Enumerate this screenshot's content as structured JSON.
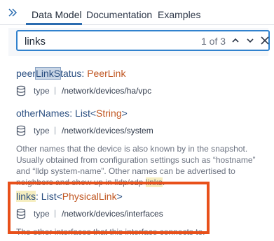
{
  "tabs": {
    "collapse_icon": "double-chevron-right-icon",
    "items": [
      {
        "label": "Data Model",
        "active": true
      },
      {
        "label": "Documentation",
        "active": false
      },
      {
        "label": "Examples",
        "active": false
      }
    ]
  },
  "search": {
    "value": "links",
    "match_count": "1 of 3",
    "prev_icon": "chevron-up-icon",
    "next_icon": "chevron-down-icon",
    "clear_icon": "close-icon"
  },
  "entries": [
    {
      "name_prefix": "peer",
      "name_match": "LinkS",
      "name_suffix": "tatus",
      "colon": ": ",
      "type": "PeerLink",
      "meta_label": "type",
      "path": "/network/devices/ha/vpc"
    },
    {
      "name": "otherNames",
      "colon": ": ",
      "type_outer": "List",
      "lt": "<",
      "type_inner": "String",
      "gt": ">",
      "meta_label": "type",
      "path": "/network/devices/system",
      "desc_main": "Other names that the device is also known by in the snapshot. Usually obtained from configuration settings such as “hostname” and “lldp system-name”. Other names can be advertised to neighbors and show up in lldp/cdp ",
      "desc_match": "links",
      "desc_end": "."
    },
    {
      "name": "links",
      "colon": ": ",
      "type_outer": "List",
      "lt": "<",
      "type_inner": "PhysicalLink",
      "gt": ">",
      "meta_label": "type",
      "path": "/network/devices/interfaces",
      "desc": "The other interfaces that this interface connects to."
    }
  ],
  "colors": {
    "accent": "#2b6cb0",
    "type_color": "#c05621",
    "highlight_box": "#e8501a"
  }
}
